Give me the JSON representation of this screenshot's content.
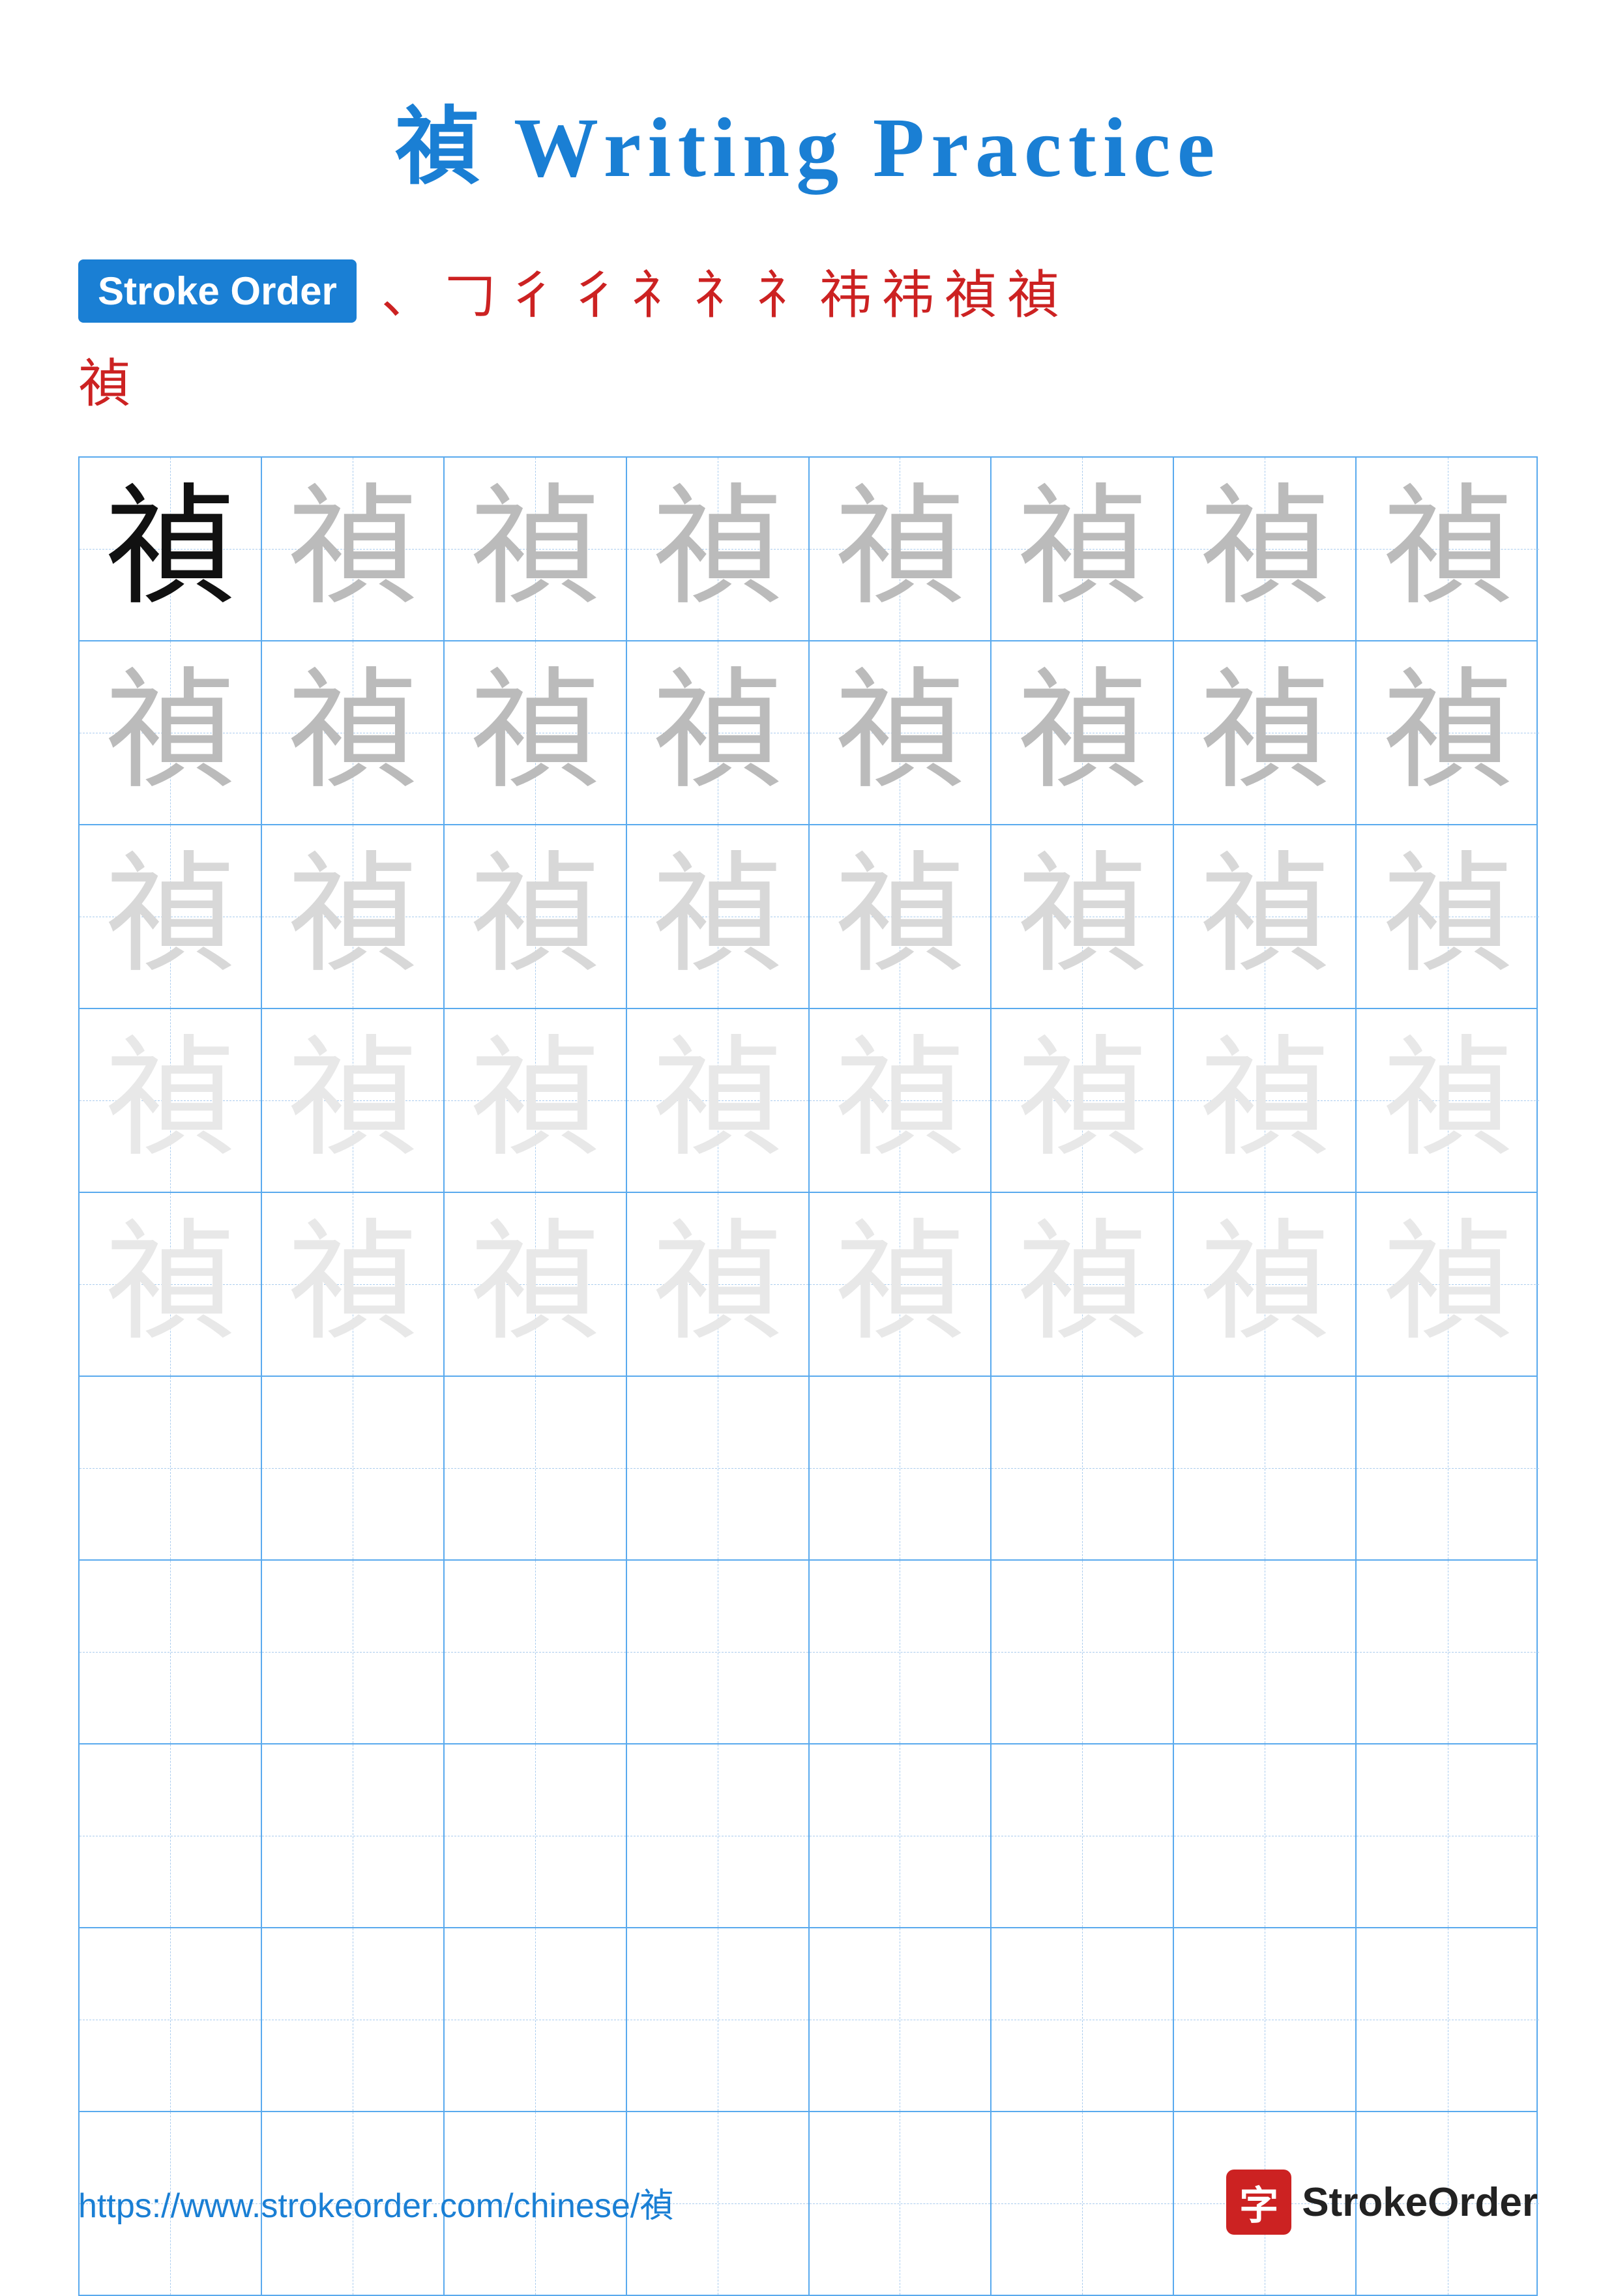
{
  "page": {
    "title": "禎 Writing Practice",
    "title_char": "禎",
    "title_suffix": " Writing Practice"
  },
  "stroke_order": {
    "badge_label": "Stroke Order",
    "chars": [
      "、",
      "𠃌",
      "彳",
      "彳",
      "礻",
      "礻",
      "礻",
      "祎",
      "祎",
      "祎",
      "禎",
      "禎"
    ],
    "last_char": "禎"
  },
  "grid": {
    "character": "禎",
    "rows": 10,
    "cols": 8,
    "practice_rows_with_chars": 5,
    "empty_rows": 5
  },
  "footer": {
    "url": "https://www.strokeorder.com/chinese/禎",
    "logo_char": "字",
    "logo_text": "StrokeOrder"
  }
}
